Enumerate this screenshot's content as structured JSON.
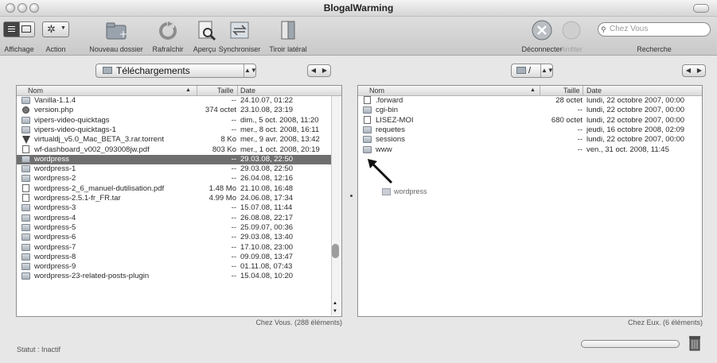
{
  "window": {
    "title": "BlogalWarming"
  },
  "toolbar": {
    "affichage": "Affichage",
    "action": "Action",
    "nouveau_dossier": "Nouveau dossier",
    "rafraichir": "Rafraîchir",
    "apercu": "Aperçu",
    "synchroniser": "Synchroniser",
    "tiroir_lateral": "Tiroir latéral",
    "deconnecter": "Déconnecter",
    "arreter": "Arrêter",
    "search_placeholder": "Chez Vous",
    "recherche": "Recherche"
  },
  "local": {
    "path": "Téléchargements",
    "headers": {
      "name": "Nom",
      "size": "Taille",
      "date": "Date"
    },
    "rows": [
      {
        "icon": "folder",
        "name": "Vanilla-1.1.4",
        "size": "--",
        "date": "24.10.07, 01:22"
      },
      {
        "icon": "php",
        "name": "version.php",
        "size": "374 octet",
        "date": "23.10.08, 23:19"
      },
      {
        "icon": "folder",
        "name": "vipers-video-quicktags",
        "size": "--",
        "date": "dim., 5 oct. 2008, 11:20"
      },
      {
        "icon": "folder",
        "name": "vipers-video-quicktags-1",
        "size": "--",
        "date": "mer., 8 oct. 2008, 16:11"
      },
      {
        "icon": "torrent",
        "name": "virtualdj_v5.0_Mac_BETA_3.rar.torrent",
        "size": "8 Ko",
        "date": "mer., 9 avr. 2008, 13:42"
      },
      {
        "icon": "doc",
        "name": "wf-dashboard_v002_093008jw.pdf",
        "size": "803 Ko",
        "date": "mer., 1 oct. 2008, 20:19"
      },
      {
        "icon": "folder",
        "name": "wordpress",
        "size": "--",
        "date": "29.03.08, 22:50",
        "selected": true
      },
      {
        "icon": "folder",
        "name": "wordpress-1",
        "size": "--",
        "date": "29.03.08, 22:50"
      },
      {
        "icon": "folder",
        "name": "wordpress-2",
        "size": "--",
        "date": "26.04.08, 12:16"
      },
      {
        "icon": "doc",
        "name": "wordpress-2_6_manuel-dutilisation.pdf",
        "size": "1.48 Mo",
        "date": "21.10.08, 16:48"
      },
      {
        "icon": "doc",
        "name": "wordpress-2.5.1-fr_FR.tar",
        "size": "4.99 Mo",
        "date": "24.06.08, 17:34"
      },
      {
        "icon": "folder",
        "name": "wordpress-3",
        "size": "--",
        "date": "15.07.08, 11:44"
      },
      {
        "icon": "folder",
        "name": "wordpress-4",
        "size": "--",
        "date": "26.08.08, 22:17"
      },
      {
        "icon": "folder",
        "name": "wordpress-5",
        "size": "--",
        "date": "25.09.07, 00:36"
      },
      {
        "icon": "folder",
        "name": "wordpress-6",
        "size": "--",
        "date": "29.03.08, 13:40"
      },
      {
        "icon": "folder",
        "name": "wordpress-7",
        "size": "--",
        "date": "17.10.08, 23:00"
      },
      {
        "icon": "folder",
        "name": "wordpress-8",
        "size": "--",
        "date": "09.09.08, 13:47"
      },
      {
        "icon": "folder",
        "name": "wordpress-9",
        "size": "--",
        "date": "01.11.08, 07:43"
      },
      {
        "icon": "folder",
        "name": "wordpress-23-related-posts-plugin",
        "size": "--",
        "date": "15.04.08, 10:20"
      }
    ],
    "count": "Chez Vous. (288 éléments)"
  },
  "remote": {
    "path": "/",
    "headers": {
      "name": "Nom",
      "size": "Taille",
      "date": "Date"
    },
    "rows": [
      {
        "icon": "doc",
        "name": ".forward",
        "size": "28 octet",
        "date": "lundi, 22 octobre 2007, 00:00"
      },
      {
        "icon": "folder",
        "name": "cgi-bin",
        "size": "--",
        "date": "lundi, 22 octobre 2007, 00:00"
      },
      {
        "icon": "doc",
        "name": "LISEZ-MOI",
        "size": "680 octet",
        "date": "lundi, 22 octobre 2007, 00:00"
      },
      {
        "icon": "folder",
        "name": "requetes",
        "size": "--",
        "date": "jeudi, 16 octobre 2008, 02:09"
      },
      {
        "icon": "folder",
        "name": "sessions",
        "size": "--",
        "date": "lundi, 22 octobre 2007, 00:00"
      },
      {
        "icon": "folder",
        "name": "www",
        "size": "--",
        "date": "ven., 31 oct. 2008, 11:45"
      }
    ],
    "drag_label": "wordpress",
    "count": "Chez Eux. (6 éléments)"
  },
  "status": "Statut : Inactif"
}
